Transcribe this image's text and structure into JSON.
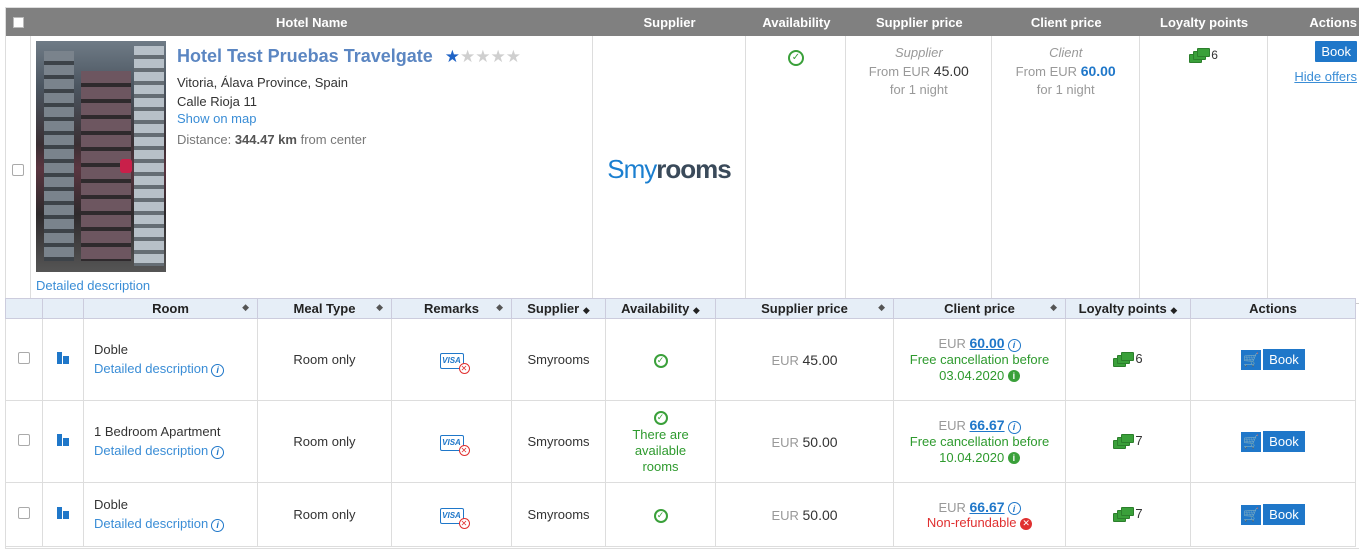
{
  "header": {
    "hotel_name": "Hotel Name",
    "supplier": "Supplier",
    "availability": "Availability",
    "supplier_price": "Supplier price",
    "client_price": "Client price",
    "loyalty_points": "Loyalty points",
    "actions": "Actions"
  },
  "hotel": {
    "name": "Hotel Test Pruebas Travelgate",
    "stars_filled": 1,
    "stars_total": 5,
    "location": "Vitoria, Álava Province, Spain",
    "address": "Calle Rioja 11",
    "show_on_map": "Show on map",
    "distance_prefix": "Distance:",
    "distance_value": "344.47 km",
    "distance_suffix": "from center",
    "detailed_description": "Detailed description",
    "supplier_logo_a": "Smy",
    "supplier_logo_b": "rooms",
    "supplier_label": "Supplier",
    "supplier_from": "From EUR",
    "supplier_amount": "45.00",
    "supplier_nights": "for 1 night",
    "client_label": "Client",
    "client_from": "From EUR",
    "client_amount": "60.00",
    "client_nights": "for 1 night",
    "loyalty": "6",
    "book": "Book",
    "hide_offers": "Hide offers"
  },
  "offers_header": {
    "room": "Room",
    "meal_type": "Meal Type",
    "remarks": "Remarks",
    "supplier": "Supplier",
    "availability": "Availability",
    "supplier_price": "Supplier price",
    "client_price": "Client price",
    "loyalty_points": "Loyalty points",
    "actions": "Actions"
  },
  "offers": [
    {
      "room": "Doble",
      "detailed": "Detailed description",
      "meal": "Room only",
      "supplier": "Smyrooms",
      "availability_text": "",
      "supplier_currency": "EUR",
      "supplier_price": "45.00",
      "client_currency": "EUR",
      "client_price": "60.00",
      "cancel_line1": "Free cancellation before",
      "cancel_line2": "03.04.2020",
      "loyalty": "6",
      "book": "Book"
    },
    {
      "room": "1 Bedroom Apartment",
      "detailed": "Detailed description",
      "meal": "Room only",
      "supplier": "Smyrooms",
      "availability_text": "There are available rooms",
      "supplier_currency": "EUR",
      "supplier_price": "50.00",
      "client_currency": "EUR",
      "client_price": "66.67",
      "cancel_line1": "Free cancellation before",
      "cancel_line2": "10.04.2020",
      "loyalty": "7",
      "book": "Book"
    },
    {
      "room": "Doble",
      "detailed": "Detailed description",
      "meal": "Room only",
      "supplier": "Smyrooms",
      "availability_text": "",
      "supplier_currency": "EUR",
      "supplier_price": "50.00",
      "client_currency": "EUR",
      "client_price": "66.67",
      "nonrefundable": "Non-refundable",
      "loyalty": "7",
      "book": "Book"
    }
  ],
  "icons": {
    "sort": "sort-icon",
    "info": "info-icon",
    "cart": "cart-icon",
    "visa": "visa-card-icon",
    "building": "building-icon",
    "money": "money-icon",
    "check": "check-circle-icon"
  },
  "colors": {
    "header_bg": "#808080",
    "accent": "#1f77c9",
    "success": "#3aa03a",
    "danger": "#e03030"
  }
}
